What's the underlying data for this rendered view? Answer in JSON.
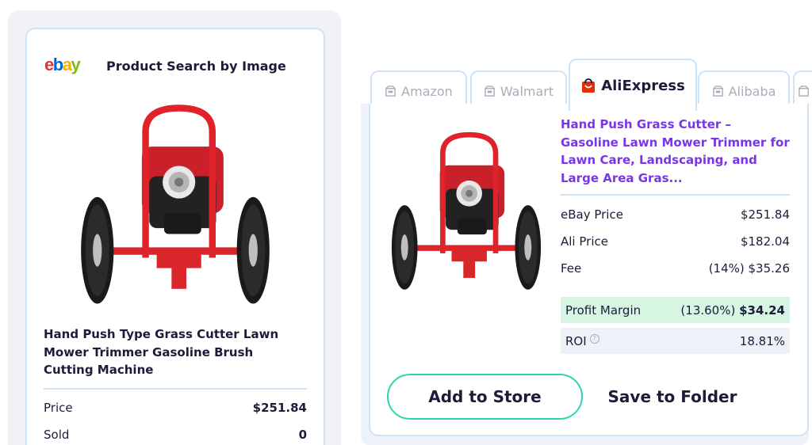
{
  "ebay_panel": {
    "logo": {
      "e": "e",
      "b": "b",
      "a": "a",
      "y": "y"
    },
    "title": "Product Search by Image",
    "product_title": "Hand Push Type Grass Cutter Lawn Mower Trimmer Gasoline Brush Cutting Machine",
    "rows": [
      {
        "label": "Price",
        "value": "$251.84"
      },
      {
        "label": "Sold",
        "value": "0"
      }
    ]
  },
  "tabs": [
    {
      "label": "Amazon",
      "icon": "box-icon",
      "active": false
    },
    {
      "label": "Walmart",
      "icon": "box-icon",
      "active": false
    },
    {
      "label": "AliExpress",
      "icon": "aliexpress-bag-icon",
      "active": true
    },
    {
      "label": "Alibaba",
      "icon": "box-icon",
      "active": false
    }
  ],
  "ali_panel": {
    "product_title": "Hand Push Grass Cutter – Gasoline Lawn Mower Trimmer for Lawn Care, Landscaping, and Large Area Gras...",
    "rows": [
      {
        "label": "eBay Price",
        "value": "$251.84"
      },
      {
        "label": "Ali Price",
        "value": "$182.04"
      },
      {
        "label": "Fee",
        "value": "(14%) $35.26"
      }
    ],
    "profit": {
      "label": "Profit Margin",
      "percent": "(13.60%)",
      "value": "$34.24"
    },
    "roi": {
      "label": "ROI",
      "info": "?",
      "value": "18.81%"
    },
    "add_button": "Add to Store",
    "save_button": "Save to Folder"
  },
  "colors": {
    "accent_purple": "#7a35e8",
    "profit_green_bg": "#d6f5e2",
    "button_teal": "#2dd4b0",
    "border_blue": "#cfe3f7"
  }
}
